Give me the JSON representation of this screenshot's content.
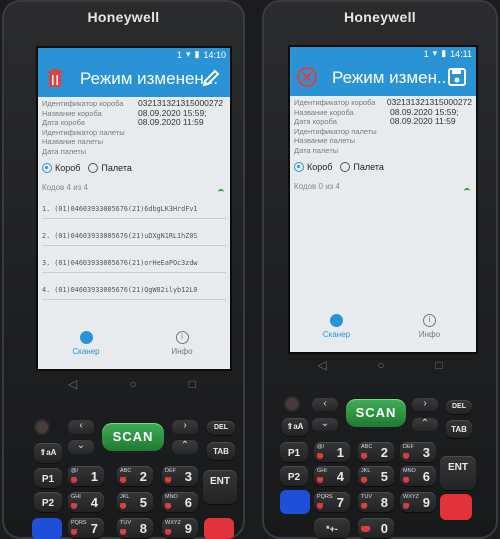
{
  "left": {
    "brand": "Honeywell",
    "status": {
      "num": "1",
      "time": "14:10"
    },
    "title": "Режим изменен...",
    "fields": [
      {
        "label": "Идентификатор короба",
        "value": "032131321315000272"
      },
      {
        "label": "Название короба",
        "value": "08.09.2020 15:59;"
      },
      {
        "label": "Дата короба",
        "value": "08.09.2020 11:59"
      },
      {
        "label": "Идентификатор палеты",
        "value": ""
      },
      {
        "label": "Название палеты",
        "value": ""
      },
      {
        "label": "Дата палеты",
        "value": ""
      }
    ],
    "radio": {
      "box": "Короб",
      "pallet": "Палета",
      "selected": "box"
    },
    "codes_count": "Кодов 4 из 4",
    "codes": [
      "1. (01)04603933005676(21)6dbgLK3HrdFv1",
      "2. (01)04603933005676(21)uDXgN1RL1hZ0S",
      "3. (01)04603933005676(21)orHeEaPOc3zdw",
      "4. (01)04603933005676(21)QgW82ilyb12L0"
    ],
    "nav": {
      "scanner": "Сканер",
      "info": "Инфо"
    }
  },
  "right": {
    "brand": "Honeywell",
    "status": {
      "num": "1",
      "time": "14:11"
    },
    "title": "Режим измен...",
    "fields": [
      {
        "label": "Идентификатор короба",
        "value": "032131321315000272"
      },
      {
        "label": "Название короба",
        "value": "08.09.2020 15:59;"
      },
      {
        "label": "Дата короба",
        "value": "08.09.2020 11:59"
      },
      {
        "label": "Идентификатор палеты",
        "value": ""
      },
      {
        "label": "Название палеты",
        "value": ""
      },
      {
        "label": "Дата палеты",
        "value": ""
      }
    ],
    "radio": {
      "box": "Короб",
      "pallet": "Палета",
      "selected": "box"
    },
    "codes_count": "Кодов 0 из 4",
    "nav": {
      "scanner": "Сканер",
      "info": "Инфо"
    }
  },
  "keypad": {
    "scan": "SCAN",
    "del": "DEL",
    "tab": "TAB",
    "ent": "ENT",
    "p1": "P1",
    "p2": "P2",
    "shift": "⇑aA",
    "keys": [
      {
        "sub": "@/",
        "fn": "F1",
        "main": "1"
      },
      {
        "sub": "ABC",
        "fn": "F2",
        "main": "2"
      },
      {
        "sub": "DEF",
        "fn": "F3",
        "main": "3"
      },
      {
        "sub": "GHI",
        "fn": "F4",
        "main": "4"
      },
      {
        "sub": "JKL",
        "fn": "F5",
        "main": "5"
      },
      {
        "sub": "MNO",
        "fn": "F6",
        "main": "6"
      },
      {
        "sub": "PQRS",
        "fn": "F7",
        "main": "7"
      },
      {
        "sub": "TUV",
        "fn": "F8",
        "main": "8"
      },
      {
        "sub": "WXYZ",
        "fn": "F9",
        "main": "9"
      }
    ],
    "star": "*+-",
    "zero_fn": "F10",
    "zero": "0"
  },
  "colors": {
    "accent": "#2a93d5",
    "scan_green": "#3fae55",
    "red_key": "#e2333a",
    "blue_key": "#1f4fd8"
  }
}
